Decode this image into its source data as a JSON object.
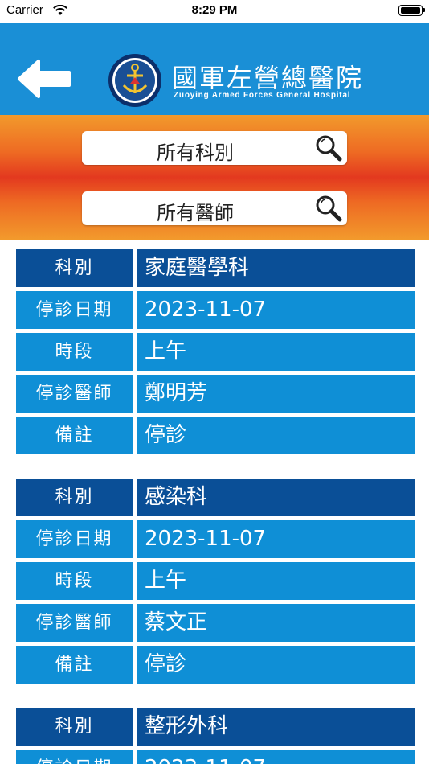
{
  "status_bar": {
    "carrier": "Carrier",
    "time": "8:29 PM"
  },
  "header": {
    "title": "國軍左營總醫院",
    "subtitle": "Zuoying Armed Forces General Hospital",
    "back_icon": "back-arrow-icon",
    "logo_icon": "anchor-emblem-icon"
  },
  "filters": {
    "department": "所有科別",
    "doctor": "所有醫師",
    "icon": "search-icon"
  },
  "field_labels": {
    "department": "科別",
    "date": "停診日期",
    "session": "時段",
    "doctor": "停診醫師",
    "note": "備註"
  },
  "records": [
    {
      "department": "家庭醫學科",
      "date": "2023-11-07",
      "session": "上午",
      "doctor": "鄭明芳",
      "note": "停診"
    },
    {
      "department": "感染科",
      "date": "2023-11-07",
      "session": "上午",
      "doctor": "蔡文正",
      "note": "停診"
    },
    {
      "department": "整形外科",
      "date": "2023-11-07"
    }
  ],
  "colors": {
    "header_blue": "#1a8fd6",
    "row_blue": "#0f8fd6",
    "row_dark_blue": "#0a4f97",
    "filter_orange": "#ee6a23",
    "filter_red": "#e3391f"
  }
}
